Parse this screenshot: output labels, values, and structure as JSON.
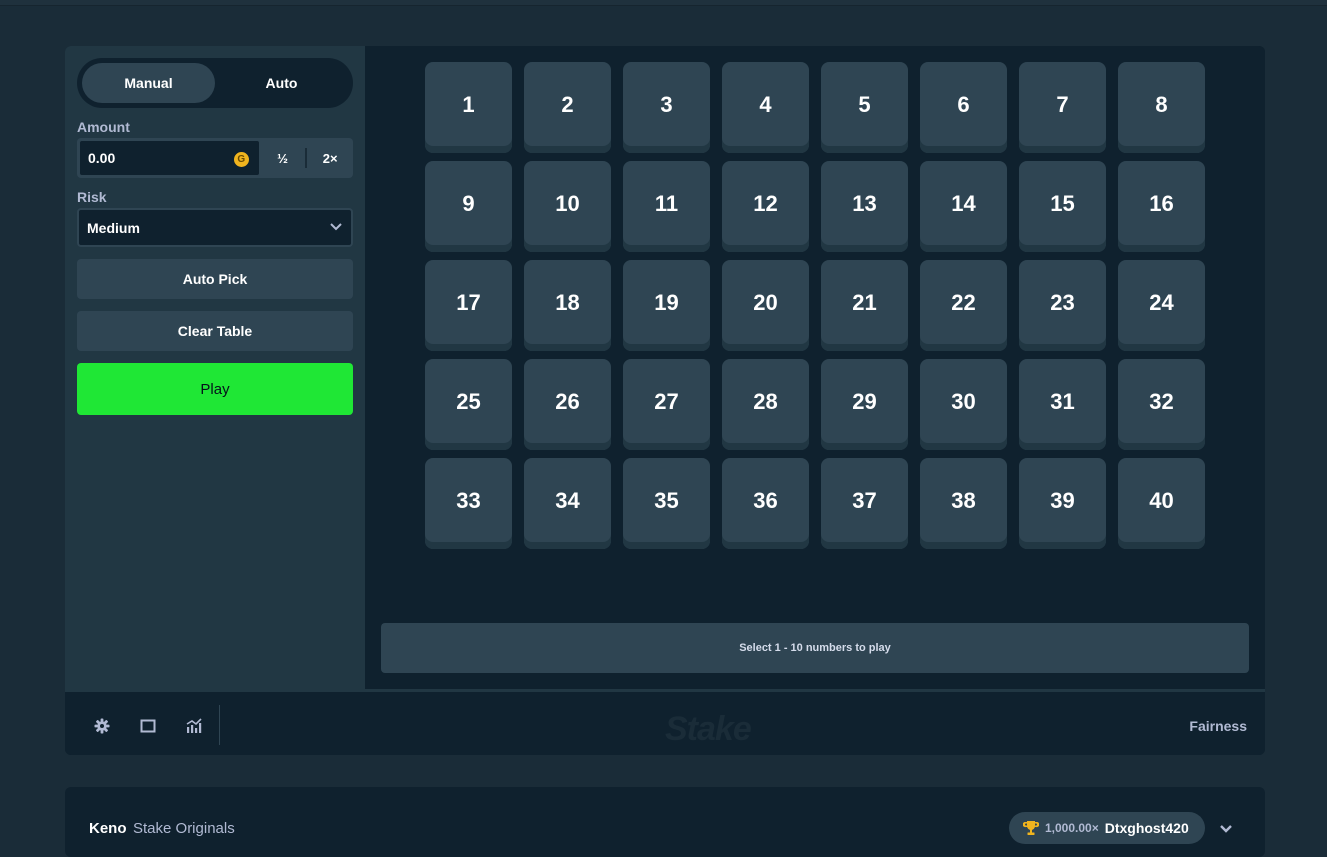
{
  "mode_toggle": {
    "manual_label": "Manual",
    "auto_label": "Auto"
  },
  "amount": {
    "label": "Amount",
    "value": "0.00",
    "coin_symbol": "G",
    "half_label": "½",
    "double_label": "2×"
  },
  "risk": {
    "label": "Risk",
    "selected": "Medium"
  },
  "buttons": {
    "auto_pick": "Auto Pick",
    "clear_table": "Clear Table",
    "play": "Play"
  },
  "tiles": [
    "1",
    "2",
    "3",
    "4",
    "5",
    "6",
    "7",
    "8",
    "9",
    "10",
    "11",
    "12",
    "13",
    "14",
    "15",
    "16",
    "17",
    "18",
    "19",
    "20",
    "21",
    "22",
    "23",
    "24",
    "25",
    "26",
    "27",
    "28",
    "29",
    "30",
    "31",
    "32",
    "33",
    "34",
    "35",
    "36",
    "37",
    "38",
    "39",
    "40"
  ],
  "info_bar": "Select 1 - 10 numbers to play",
  "footer": {
    "logo": "Stake",
    "fairness": "Fairness"
  },
  "game_info": {
    "name": "Keno",
    "provider": "Stake Originals",
    "top_win_amount": "1,000.00×",
    "top_winner": "Dtxghost420"
  },
  "colors": {
    "accent_play": "#1fe735",
    "panel": "#213743",
    "tile": "#2f4553",
    "background": "#1a2c38",
    "board": "#0f212e"
  }
}
